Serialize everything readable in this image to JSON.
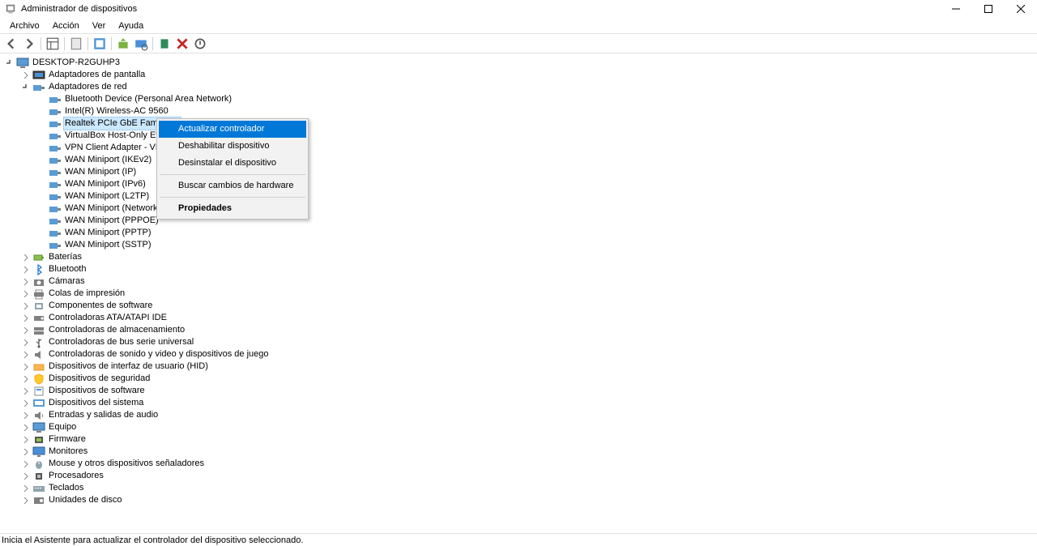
{
  "title": "Administrador de dispositivos",
  "menu": {
    "archivo": "Archivo",
    "accion": "Acción",
    "ver": "Ver",
    "ayuda": "Ayuda"
  },
  "tree": {
    "root": "DESKTOP-R2GUHP3",
    "adaptadores_pantalla": "Adaptadores de pantalla",
    "adaptadores_red": "Adaptadores de red",
    "net1": "Bluetooth Device (Personal Area Network)",
    "net2": "Intel(R) Wireless-AC 9560",
    "net3": "Realtek PCIe GbE Family Co",
    "net4": "VirtualBox Host-Only Ethern",
    "net5": "VPN Client Adapter - VPN2",
    "net6": "WAN Miniport (IKEv2)",
    "net7": "WAN Miniport (IP)",
    "net8": "WAN Miniport (IPv6)",
    "net9": "WAN Miniport (L2TP)",
    "net10": "WAN Miniport (Network Monitor)",
    "net11": "WAN Miniport (PPPOE)",
    "net12": "WAN Miniport (PPTP)",
    "net13": "WAN Miniport (SSTP)",
    "baterias": "Baterías",
    "bluetooth": "Bluetooth",
    "camaras": "Cámaras",
    "colas_impresion": "Colas de impresión",
    "componentes_software": "Componentes de software",
    "controladoras_ata": "Controladoras ATA/ATAPI IDE",
    "controladoras_almacenamiento": "Controladoras de almacenamiento",
    "controladoras_usb": "Controladoras de bus serie universal",
    "controladoras_sonido": "Controladoras de sonido y video y dispositivos de juego",
    "hid": "Dispositivos de interfaz de usuario (HID)",
    "seguridad": "Dispositivos de seguridad",
    "dispositivos_software": "Dispositivos de software",
    "dispositivos_sistema": "Dispositivos del sistema",
    "audio": "Entradas y salidas de audio",
    "equipo": "Equipo",
    "firmware": "Firmware",
    "monitores": "Monitores",
    "mouse": "Mouse y otros dispositivos señaladores",
    "procesadores": "Procesadores",
    "teclados": "Teclados",
    "unidades_disco": "Unidades de disco"
  },
  "context_menu": {
    "actualizar": "Actualizar controlador",
    "deshabilitar": "Deshabilitar dispositivo",
    "desinstalar": "Desinstalar el dispositivo",
    "buscar": "Buscar cambios de hardware",
    "propiedades": "Propiedades"
  },
  "status": "Inicia el Asistente para actualizar el controlador del dispositivo seleccionado."
}
